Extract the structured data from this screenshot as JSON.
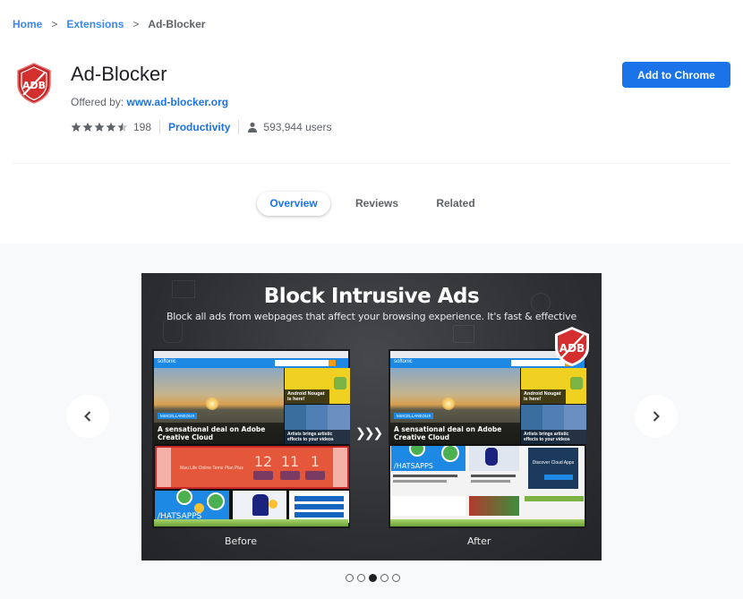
{
  "breadcrumb": [
    {
      "label": "Home",
      "link": true
    },
    {
      "label": "Extensions",
      "link": true
    },
    {
      "label": "Ad-Blocker",
      "link": false
    }
  ],
  "breadcrumb_separator": ">",
  "extension": {
    "icon": "adb-shield-icon",
    "title": "Ad-Blocker",
    "offered_by_label": "Offered by:",
    "offered_by_link": "www.ad-blocker.org",
    "rating": 4.5,
    "rating_max": 5,
    "rating_count": "198",
    "category": "Productivity",
    "users": "593,944 users",
    "add_button": "Add to Chrome"
  },
  "colors": {
    "accent": "#1a73e8",
    "brand_red": "#c62828"
  },
  "tabs": [
    {
      "label": "Overview",
      "active": true
    },
    {
      "label": "Reviews",
      "active": false
    },
    {
      "label": "Related",
      "active": false
    }
  ],
  "gallery": {
    "slide": {
      "title": "Block Intrusive Ads",
      "subtitle": "Block all ads from webpages that affect your browsing experience. It's fast & effective",
      "badge_text": "ADB",
      "transition_glyph": "❯❯❯",
      "before": {
        "label": "Before",
        "site_logo": "softonic",
        "hero_tag": "MISCELLANEOUS",
        "hero_caption": "A sensational deal on Adobe Creative Cloud",
        "side_caption_1": "Android Nougat is here!",
        "side_caption_2": "Artists brings artistic effects to your videos",
        "ad_text": "Mau Life Online Tems Plan Plus",
        "countdown": [
          "12",
          "11",
          "1"
        ],
        "tile_label": "/HATSAPPS"
      },
      "after": {
        "label": "After",
        "site_logo": "softonic",
        "hero_tag": "MISCELLANEOUS",
        "hero_caption": "A sensational deal on Adobe Creative Cloud",
        "side_caption_1": "Android Nougat is here!",
        "side_caption_2": "Artists brings artistic effects to your videos",
        "tile_label": "/HATSAPPS",
        "ad_text": "Discover Cloud Apps"
      }
    },
    "prev_icon": "chevron-left-icon",
    "next_icon": "chevron-right-icon",
    "slide_count": 5,
    "active_slide": 3
  }
}
